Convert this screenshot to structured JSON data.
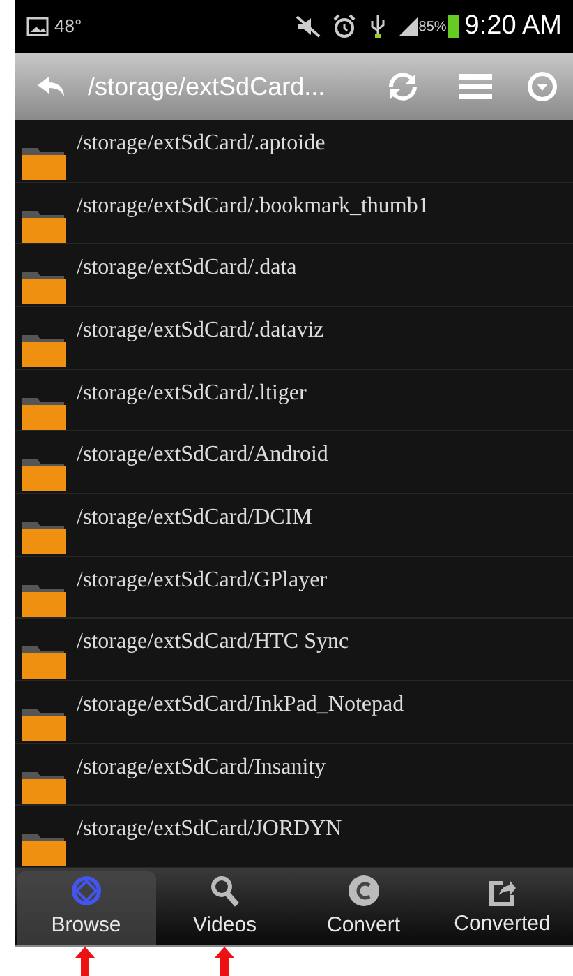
{
  "status_bar": {
    "temperature": "48°",
    "battery_percent": "85%",
    "time": "9:20 AM"
  },
  "toolbar": {
    "path": "/storage/extSdCard..."
  },
  "folders": [
    {
      "path": "/storage/extSdCard/.aptoide"
    },
    {
      "path": "/storage/extSdCard/.bookmark_thumb1"
    },
    {
      "path": "/storage/extSdCard/.data"
    },
    {
      "path": "/storage/extSdCard/.dataviz"
    },
    {
      "path": "/storage/extSdCard/.ltiger"
    },
    {
      "path": "/storage/extSdCard/Android"
    },
    {
      "path": "/storage/extSdCard/DCIM"
    },
    {
      "path": "/storage/extSdCard/GPlayer"
    },
    {
      "path": "/storage/extSdCard/HTC Sync"
    },
    {
      "path": "/storage/extSdCard/InkPad_Notepad"
    },
    {
      "path": "/storage/extSdCard/Insanity"
    },
    {
      "path": "/storage/extSdCard/JORDYN"
    }
  ],
  "tabs": [
    {
      "label": "Browse",
      "kind": "browse",
      "selected": true,
      "arrow": true
    },
    {
      "label": "Videos",
      "kind": "videos",
      "selected": false,
      "arrow": true
    },
    {
      "label": "Convert",
      "kind": "convert",
      "selected": false,
      "arrow": false
    },
    {
      "label": "Converted",
      "kind": "converted",
      "selected": false,
      "arrow": false
    }
  ]
}
